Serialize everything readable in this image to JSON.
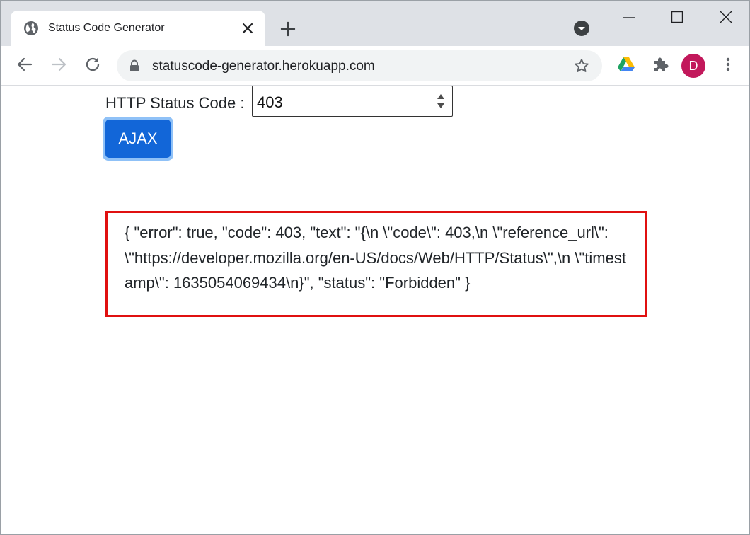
{
  "browser": {
    "tab": {
      "title": "Status Code Generator"
    },
    "omnibox": {
      "url": "statuscode-generator.herokuapp.com"
    },
    "profile": {
      "initial": "D",
      "color": "#c2185b"
    }
  },
  "page": {
    "status_label": "HTTP Status Code :",
    "status_value": "403",
    "ajax_label": "AJAX",
    "result_text": "{ \"error\": true, \"code\": 403, \"text\": \"{\\n \\\"code\\\": 403,\\n \\\"reference_url\\\": \\\"https://developer.mozilla.org/en-US/docs/Web/HTTP/Status\\\",\\n \\\"timestamp\\\": 1635054069434\\n}\", \"status\": \"Forbidden\" }"
  },
  "colors": {
    "button": "#1266d8",
    "button_focus_ring": "#8fc1f7",
    "result_border": "#e01010"
  }
}
